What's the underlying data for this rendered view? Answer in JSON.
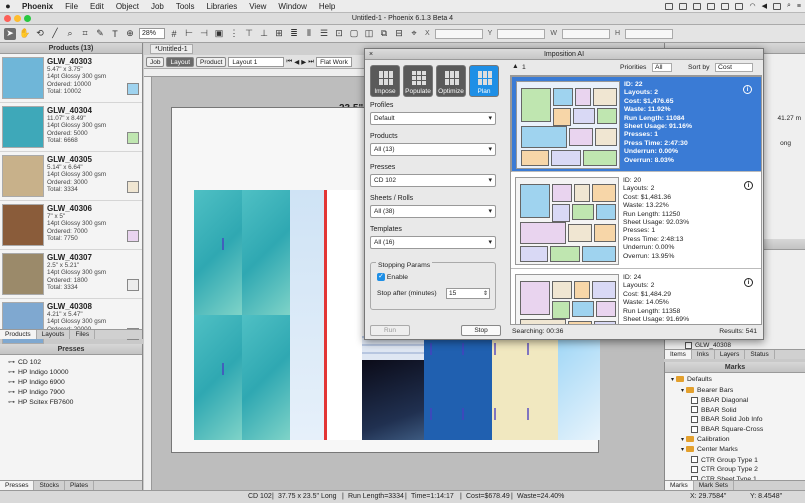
{
  "menubar": {
    "app": "Phoenix",
    "items": [
      "File",
      "Edit",
      "Object",
      "Job",
      "Tools",
      "Libraries",
      "View",
      "Window",
      "Help"
    ]
  },
  "window": {
    "title": "Untitled-1 - Phoenix 6.1.3 Beta 4"
  },
  "toolbar": {
    "zoom": "28%",
    "coord_x": "X",
    "coord_y": "Y",
    "coord_w": "W",
    "coord_h": "H"
  },
  "products_panel": {
    "title": "Products (13)",
    "items": [
      {
        "name": "GLW_40303",
        "size": "5.47\" x 3.75\"",
        "stock": "14pt Glossy 300 gsm",
        "ordered": "Ordered: 10000",
        "total": "Total: 10002",
        "swatch": "#9fd3ef"
      },
      {
        "name": "GLW_40304",
        "size": "11.07\" x 8.49\"",
        "stock": "14pt Glossy 300 gsm",
        "ordered": "Ordered: 5000",
        "total": "Total: 6668",
        "swatch": "#bfe6b0"
      },
      {
        "name": "GLW_40305",
        "size": "5.14\" x 6.64\"",
        "stock": "14pt Glossy 300 gsm",
        "ordered": "Ordered: 3000",
        "total": "Total: 3334",
        "swatch": "#f0e6d2"
      },
      {
        "name": "GLW_40306",
        "size": "7\" x 5\"",
        "stock": "14pt Glossy 300 gsm",
        "ordered": "Ordered: 7000",
        "total": "Total: 7750",
        "swatch": "#e9d4ef"
      },
      {
        "name": "GLW_40307",
        "size": "2.5\" x 5.21\"",
        "stock": "14pt Glossy 300 gsm",
        "ordered": "Ordered: 1800",
        "total": "Total: 3334",
        "swatch": "#ececec"
      },
      {
        "name": "GLW_40308",
        "size": "4.21\" x 5.47\"",
        "stock": "14pt Glossy 300 gsm",
        "ordered": "Ordered: 20000",
        "total": "",
        "swatch": "#dbe7f5"
      }
    ],
    "tabs": [
      "Products",
      "Layouts",
      "Files"
    ]
  },
  "presses_panel": {
    "title": "Presses",
    "items": [
      "CD 102",
      "HP Indigo 10000",
      "HP Indigo 6900",
      "HP Indigo 7900",
      "HP Scitex FB7600"
    ],
    "tabs": [
      "Presses",
      "Stocks",
      "Plates"
    ]
  },
  "document": {
    "tab": "*Untitled-1",
    "mode_buttons": [
      "Job",
      "Layout",
      "Product"
    ],
    "layout_select": "Layout 1",
    "flat_label": "Flat Work",
    "sheet_label": "23.5\""
  },
  "imposition_ai": {
    "title": "Imposition AI",
    "modes": [
      "Impose",
      "Populate",
      "Optimize",
      "Plan"
    ],
    "active_mode": "Plan",
    "fields": [
      {
        "label": "Profiles",
        "value": "Default"
      },
      {
        "label": "Products",
        "value": "All (13)"
      },
      {
        "label": "Presses",
        "value": "CD 102"
      },
      {
        "label": "Sheets / Rolls",
        "value": "All (38)"
      },
      {
        "label": "Templates",
        "value": "All (16)"
      }
    ],
    "stopping": {
      "title": "Stopping Params",
      "enable": "Enable",
      "stop_after": "Stop after (minutes)",
      "minutes": "15"
    },
    "run_button": "Run",
    "stop_button": "Stop",
    "warning_count": "1",
    "priorities_label": "Priorities",
    "priorities_value": "All",
    "sort_label": "Sort by",
    "sort_value": "Cost",
    "searching": "Searching: 00:36",
    "results_count": "Results: 541",
    "results": [
      {
        "lines": [
          "ID: 22",
          "Layouts: 2",
          "Cost: $1,476.65",
          "Waste: 11.92%",
          "Run Length: 11084",
          "Sheet Usage: 91.16%",
          "Presses: 1",
          "Press Time: 2:47:30",
          "Underrun: 0.00%",
          "Overrun: 8.03%"
        ],
        "selected": true
      },
      {
        "lines": [
          "ID: 20",
          "Layouts: 2",
          "Cost: $1,481.36",
          "Waste: 13.22%",
          "Run Length: 11250",
          "Sheet Usage: 92.03%",
          "Presses: 1",
          "Press Time: 2:48:13",
          "Underrun: 0.00%",
          "Overrun: 13.95%"
        ],
        "selected": false
      },
      {
        "lines": [
          "ID: 24",
          "Layouts: 2",
          "Cost: $1,484.29",
          "Waste: 14.05%",
          "Run Length: 11358",
          "Sheet Usage: 91.69%"
        ],
        "selected": false
      }
    ]
  },
  "right_panel": {
    "values": [
      "41.27 m",
      "ong"
    ],
    "items_row": "GLW_40308",
    "items_tabs": [
      "Items",
      "Inks",
      "Layers",
      "Status"
    ]
  },
  "marks_panel": {
    "title": "Marks",
    "tree": [
      {
        "label": "Defaults",
        "type": "folder",
        "level": 0
      },
      {
        "label": "Bearer Bars",
        "type": "folder",
        "level": 1
      },
      {
        "label": "BBAR Diagonal",
        "type": "mark",
        "level": 2
      },
      {
        "label": "BBAR Solid",
        "type": "mark",
        "level": 2
      },
      {
        "label": "BBAR Solid Job Info",
        "type": "mark",
        "level": 2
      },
      {
        "label": "BBAR Square-Cross",
        "type": "mark",
        "level": 2
      },
      {
        "label": "Calibration",
        "type": "folder",
        "level": 1
      },
      {
        "label": "Center Marks",
        "type": "folder",
        "level": 1
      },
      {
        "label": "CTR Group Type 1",
        "type": "mark",
        "level": 2
      },
      {
        "label": "CTR Group Type 2",
        "type": "mark",
        "level": 2
      },
      {
        "label": "CTR Sheet Type 1",
        "type": "mark",
        "level": 2
      }
    ],
    "tabs": [
      "Marks",
      "Mark Sets"
    ]
  },
  "statusbar": {
    "press": "CD 102",
    "sheet": "37.75 x 23.5\" Long",
    "run_length": "Run Length=3334",
    "time": "Time=1:14:17",
    "cost": "Cost=$678.49",
    "waste": "Waste=24.40%",
    "x": "X: 29.7584\"",
    "y": "Y: 8.4548\""
  },
  "colors": {
    "accent": "#3a7bd5",
    "plan_button": "#1e8fe6"
  }
}
